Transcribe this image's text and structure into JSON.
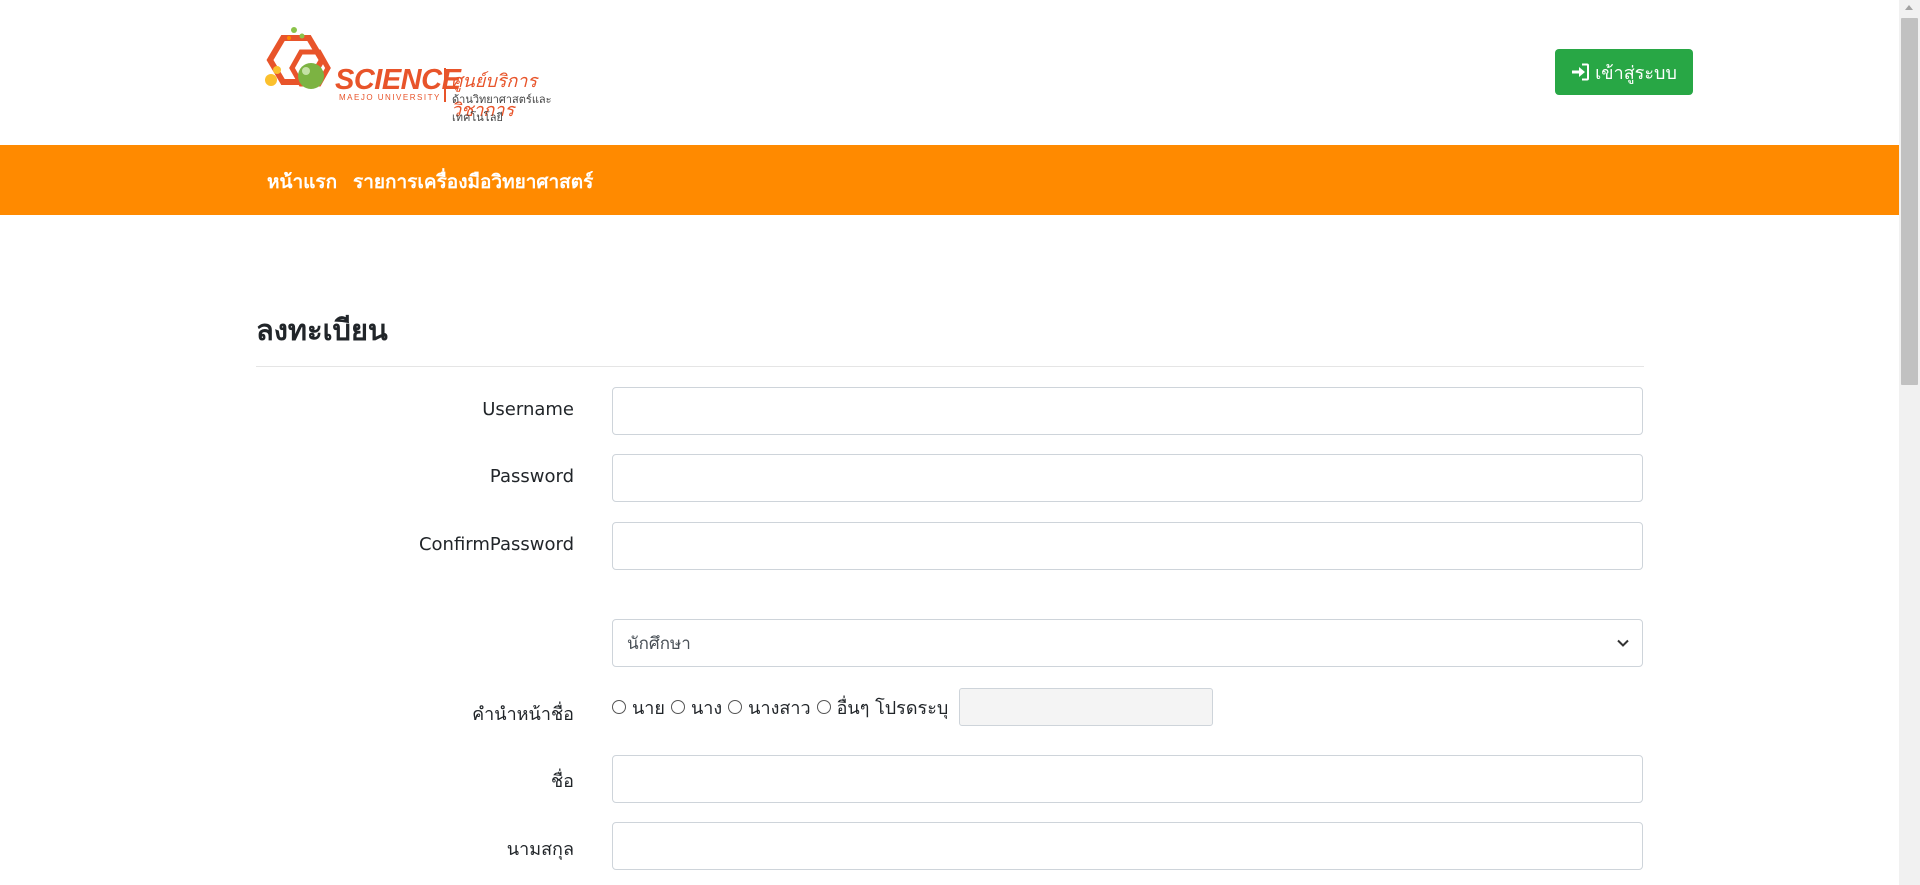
{
  "header": {
    "logo": {
      "brand": "SCIENCE",
      "brand_sub": "MAEJO UNIVERSITY",
      "thai_title": "ศูนย์บริการวิชาการ",
      "thai_subtitle": "ด้านวิทยาศาสตร์และเทคโนโลยี"
    },
    "login_label": "เข้าสู่ระบบ",
    "login_icon": "sign-in-icon"
  },
  "nav": {
    "items": [
      {
        "label": "หน้าแรก"
      },
      {
        "label": "รายการเครื่องมือวิทยาศาสตร์"
      }
    ]
  },
  "form": {
    "title": "ลงทะเบียน",
    "fields": {
      "username": {
        "label": "Username",
        "value": ""
      },
      "password": {
        "label": "Password",
        "value": ""
      },
      "confirm_password": {
        "label": "ConfirmPassword",
        "value": ""
      },
      "user_type": {
        "selected": "นักศึกษา"
      },
      "prefix": {
        "label": "คำนำหน้าชื่อ",
        "options": [
          "นาย",
          "นาง",
          "นางสาว",
          "อื่นๆ โปรดระบุ"
        ],
        "other_value": ""
      },
      "first_name": {
        "label": "ชื่อ",
        "value": ""
      },
      "last_name": {
        "label": "นามสกุล",
        "value": ""
      }
    }
  },
  "colors": {
    "accent": "#ff8a00",
    "login_button": "#28a745",
    "logo": "#e8542a"
  }
}
